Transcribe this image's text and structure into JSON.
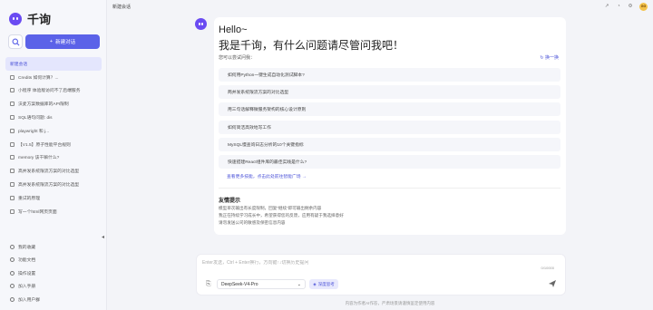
{
  "app": {
    "name": "千询"
  },
  "sidebar": {
    "new_chat_label": "新建对话",
    "history": [
      {
        "label": "新建会话",
        "active": true
      },
      {
        "label": "Credits 如何计算？..."
      },
      {
        "label": "小程序 体验版访问不了后端服务"
      },
      {
        "label": "沃麦方案数据库的API限制"
      },
      {
        "label": "SQL语句问题: dis"
      },
      {
        "label": "playwright 和 j..."
      },
      {
        "label": "【V1.5】原子性能平台规则"
      },
      {
        "label": "memory 该干嘛什么?"
      },
      {
        "label": "高并发系统限流方案的对比选型"
      },
      {
        "label": "高并发系统限流方案的对比选型"
      },
      {
        "label": "重试的原理"
      },
      {
        "label": "写一个html网页页面"
      }
    ],
    "bottom": [
      {
        "label": "我的收藏"
      },
      {
        "label": "功能文档"
      },
      {
        "label": "操作设置"
      },
      {
        "label": "加入手册"
      },
      {
        "label": "加入用户群"
      }
    ]
  },
  "topbar": {
    "title": "新建会话",
    "avatar_text": "GG"
  },
  "main": {
    "greeting_line1": "Hello~",
    "greeting_line2": "我是千询，有什么问题请尽管问我吧！",
    "ask_label": "您可以尝试问我：",
    "refresh_label": "换一换",
    "questions": [
      "如何用Python一键生成自动化测试脚本?",
      "两并发系统限流方案的对比选型",
      "用三句话解释微服务架构的核心设计原则",
      "如何简洁高效地写工作",
      "MySQL慢查询日志分析的10个关键指标",
      "快速搭建React组件库的最佳实践是什么?"
    ],
    "more_label": "查看更多技能，点击此处前往智能广场 →",
    "tips_title": "友情提示",
    "tips": [
      "模型单次输出有长度限制，回复“继续”即可输出剩余内容",
      "我正在持续学习成长中，希望获得您的反馈，应用有疑于我选择意好",
      "请勿发送公司的敏感及保密信息内容"
    ]
  },
  "composer": {
    "placeholder": "Enter发送，Ctrl + Enter换行，方向键↑↓切换历史提问",
    "counter": "0/10000",
    "model": "DeepSeek-V4-Pro",
    "deep_think_label": "深度思考"
  },
  "footer_note": "内容为作者AI作答，严肃场景请谨慎鉴定使用内容",
  "colors": {
    "accent": "#5b62e8",
    "brand": "#6a4bf2"
  }
}
